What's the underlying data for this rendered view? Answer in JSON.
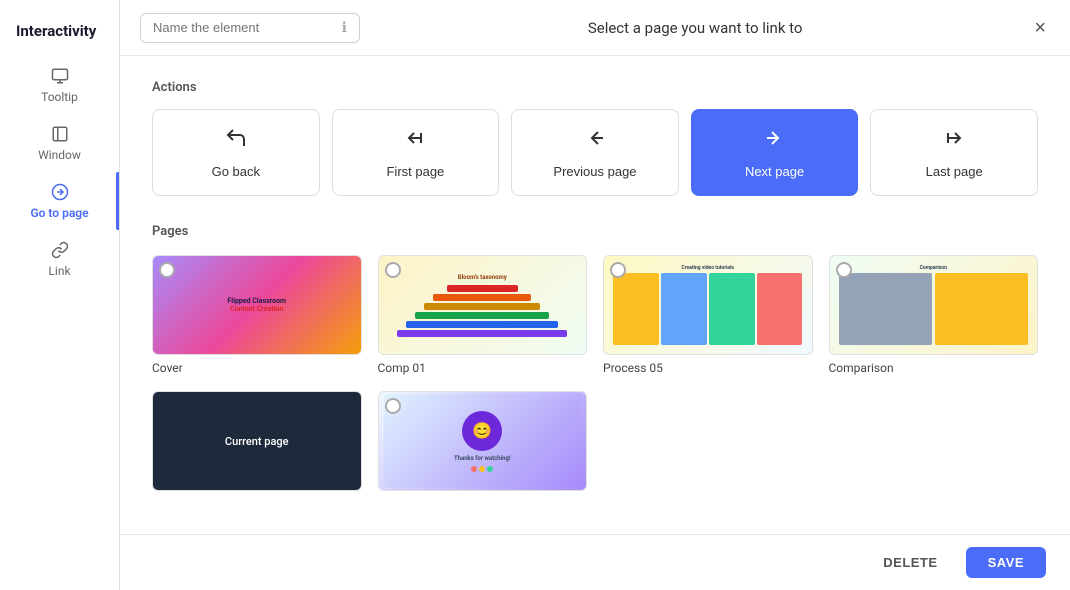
{
  "sidebar": {
    "title": "Interactivity",
    "items": [
      {
        "id": "tooltip",
        "label": "Tooltip",
        "icon": "💬"
      },
      {
        "id": "window",
        "label": "Window",
        "icon": "🪟"
      },
      {
        "id": "go-to-page",
        "label": "Go to page",
        "icon": "➡️",
        "active": true
      },
      {
        "id": "link",
        "label": "Link",
        "icon": "🔗"
      }
    ]
  },
  "header": {
    "input_placeholder": "Name the element",
    "title": "Select a page you want to link to",
    "close_label": "×"
  },
  "actions": {
    "label": "Actions",
    "buttons": [
      {
        "id": "go-back",
        "label": "Go back",
        "icon": "↩"
      },
      {
        "id": "first-page",
        "label": "First page",
        "icon": "⏮"
      },
      {
        "id": "previous-page",
        "label": "Previous page",
        "icon": "◀"
      },
      {
        "id": "next-page",
        "label": "Next page",
        "icon": "▶",
        "active": true
      },
      {
        "id": "last-page",
        "label": "Last page",
        "icon": "⏭"
      }
    ]
  },
  "pages": {
    "label": "Pages",
    "items": [
      {
        "id": "cover",
        "name": "Cover",
        "type": "cover"
      },
      {
        "id": "comp01",
        "name": "Comp 01",
        "type": "comp"
      },
      {
        "id": "process05",
        "name": "Process 05",
        "type": "process"
      },
      {
        "id": "comparison",
        "name": "Comparison",
        "type": "comparison"
      },
      {
        "id": "current",
        "name": "Current page",
        "type": "current"
      },
      {
        "id": "last",
        "name": "",
        "type": "last"
      }
    ]
  },
  "footer": {
    "delete_label": "DELETE",
    "save_label": "SAVE"
  }
}
